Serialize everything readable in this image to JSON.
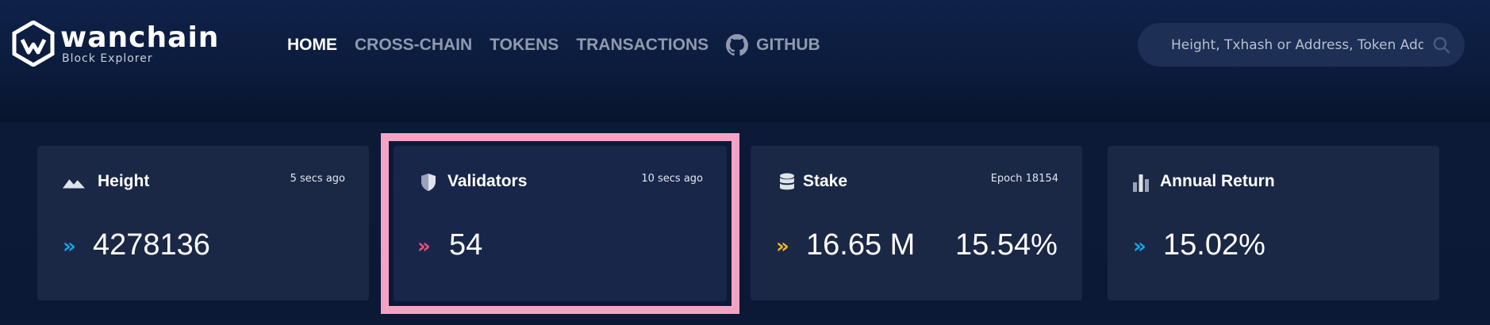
{
  "brand": {
    "name": "wanchain",
    "subtitle": "Block Explorer"
  },
  "nav": {
    "items": [
      {
        "label": "HOME",
        "active": true
      },
      {
        "label": "CROSS-CHAIN",
        "active": false
      },
      {
        "label": "TOKENS",
        "active": false
      },
      {
        "label": "TRANSACTIONS",
        "active": false
      },
      {
        "label": "GITHUB",
        "active": false,
        "icon": "github-icon"
      }
    ]
  },
  "search": {
    "placeholder": "Height, Txhash or Address, Token Addr",
    "icon": "search-icon"
  },
  "cards": {
    "height": {
      "title": "Height",
      "meta": "5 secs ago",
      "value": "4278136",
      "icon": "mountain-icon",
      "chevron": "»",
      "chevron_color": "#1aa3e8"
    },
    "validators": {
      "title": "Validators",
      "meta": "10 secs ago",
      "value": "54",
      "icon": "shield-icon",
      "chevron": "»",
      "chevron_color": "#e8537a"
    },
    "stake": {
      "title": "Stake",
      "meta": "Epoch 18154",
      "value": "16.65 M",
      "value2": "15.54%",
      "icon": "database-icon",
      "chevron": "»",
      "chevron_color": "#f0b429"
    },
    "annual_return": {
      "title": "Annual Return",
      "value": "15.02%",
      "icon": "bar-chart-icon",
      "chevron": "»",
      "chevron_color": "#1aa3e8"
    }
  },
  "colors": {
    "background": "#0b1a36",
    "card": "#1a2745",
    "highlight_border": "#f5a3c4",
    "nav_active": "#ffffff",
    "nav_inactive": "#8f9aae"
  }
}
